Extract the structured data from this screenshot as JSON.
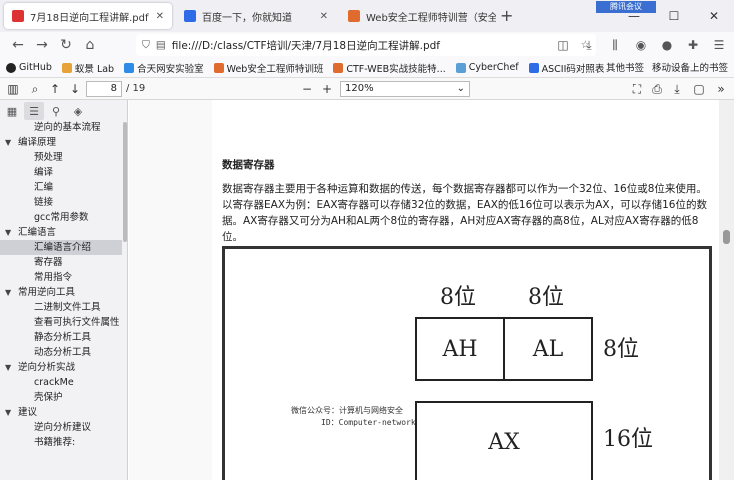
{
  "tabs": [
    {
      "title": "7月18日逆向工程讲解.pdf",
      "active": true,
      "icon_color": "#d33"
    },
    {
      "title": "百度一下，你就知道",
      "active": false,
      "icon_color": "#2e6be6"
    },
    {
      "title": "Web安全工程师特训营（安全...",
      "active": false,
      "icon_color": "#e06b2e"
    }
  ],
  "overlay_label": "腾讯会议",
  "address": {
    "url": "file:///D:/class/CTF培训/天津/7月18日逆向工程讲解.pdf"
  },
  "bookmarks": [
    {
      "label": "GitHub",
      "color": "#222"
    },
    {
      "label": "蚁景 Lab",
      "color": "#e8a23a"
    },
    {
      "label": "合天网安实验室",
      "color": "#2e8be6"
    },
    {
      "label": "Web安全工程师特训班",
      "color": "#e06b2e"
    },
    {
      "label": "CTF-WEB实战技能特...",
      "color": "#e06b2e"
    },
    {
      "label": "CyberChef",
      "color": "#5aa0d6"
    },
    {
      "label": "ASCII码对照表",
      "color": "#2e6be6"
    }
  ],
  "bookmarks_right": [
    "其他书签",
    "移动设备上的书签"
  ],
  "pdf_toolbar": {
    "page_current": "8",
    "page_total": "/ 19",
    "zoom": "120%"
  },
  "outline": [
    {
      "label": "逆向的基本流程",
      "level": 2,
      "twisty": "",
      "selected": false
    },
    {
      "label": "编译原理",
      "level": 1,
      "twisty": "▼",
      "selected": false
    },
    {
      "label": "预处理",
      "level": 2,
      "twisty": "",
      "selected": false
    },
    {
      "label": "编译",
      "level": 2,
      "twisty": "",
      "selected": false
    },
    {
      "label": "汇编",
      "level": 2,
      "twisty": "",
      "selected": false
    },
    {
      "label": "链接",
      "level": 2,
      "twisty": "",
      "selected": false
    },
    {
      "label": "gcc常用参数",
      "level": 2,
      "twisty": "",
      "selected": false
    },
    {
      "label": "汇编语言",
      "level": 1,
      "twisty": "▼",
      "selected": false
    },
    {
      "label": "汇编语言介绍",
      "level": 2,
      "twisty": "",
      "selected": true
    },
    {
      "label": "寄存器",
      "level": 2,
      "twisty": "",
      "selected": false
    },
    {
      "label": "常用指令",
      "level": 2,
      "twisty": "",
      "selected": false
    },
    {
      "label": "常用逆向工具",
      "level": 1,
      "twisty": "▼",
      "selected": false
    },
    {
      "label": "二进制文件工具",
      "level": 2,
      "twisty": "",
      "selected": false
    },
    {
      "label": "查看可执行文件属性",
      "level": 2,
      "twisty": "",
      "selected": false
    },
    {
      "label": "静态分析工具",
      "level": 2,
      "twisty": "",
      "selected": false
    },
    {
      "label": "动态分析工具",
      "level": 2,
      "twisty": "",
      "selected": false
    },
    {
      "label": "逆向分析实战",
      "level": 1,
      "twisty": "▼",
      "selected": false
    },
    {
      "label": "crackMe",
      "level": 2,
      "twisty": "",
      "selected": false
    },
    {
      "label": "壳保护",
      "level": 2,
      "twisty": "",
      "selected": false
    },
    {
      "label": "建议",
      "level": 1,
      "twisty": "▼",
      "selected": false
    },
    {
      "label": "逆向分析建议",
      "level": 2,
      "twisty": "",
      "selected": false
    },
    {
      "label": "书籍推荐:",
      "level": 2,
      "twisty": "",
      "selected": false
    }
  ],
  "document": {
    "heading": "数据寄存器",
    "paragraph": "数据寄存器主要用于各种运算和数据的传送，每个数据寄存器都可以作为一个32位、16位或8位来使用。以寄存器EAX为例：EAX寄存器可以存储32位的数据，EAX的低16位可以表示为AX，可以存储16位的数据。AX寄存器又可分为AH和AL两个8位的寄存器，AH对应AX寄存器的高8位，AL对应AX寄存器的低8位。",
    "figure": {
      "top_label_1": "8位",
      "top_label_2": "8位",
      "right_label_1": "8位",
      "box_ah": "AH",
      "box_al": "AL",
      "box_ax": "AX",
      "right_label_2": "16位",
      "watermark_line1": "微信公众号：计算机与网络安全",
      "watermark_line2": "ID：Computer-network"
    }
  }
}
